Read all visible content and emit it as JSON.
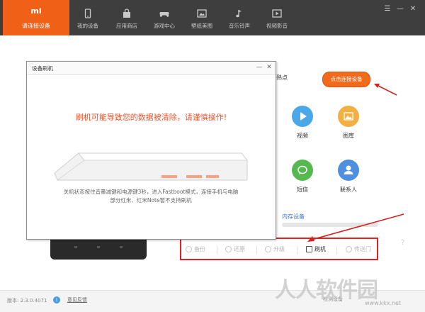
{
  "nav": {
    "brand_logo": "mi",
    "brand_label": "请连接设备",
    "items": [
      {
        "label": "我的设备",
        "icon": "phone-icon"
      },
      {
        "label": "应用商店",
        "icon": "bag-icon"
      },
      {
        "label": "游戏中心",
        "icon": "gamepad-icon"
      },
      {
        "label": "壁纸美图",
        "icon": "image-icon"
      },
      {
        "label": "音乐铃声",
        "icon": "music-icon"
      },
      {
        "label": "视频影音",
        "icon": "video-icon"
      }
    ],
    "accent_color": "#f06016"
  },
  "window_controls": {
    "menu": "☰",
    "minimize": "—",
    "close": "✕"
  },
  "main": {
    "connect_label": "熟点",
    "connect_button": "点击连接设备",
    "apps": [
      {
        "label": "视频",
        "icon": "play-icon",
        "color": "#4aa8e8"
      },
      {
        "label": "图库",
        "icon": "picture-icon",
        "color": "#f2b043"
      },
      {
        "label": "短信",
        "icon": "message-icon",
        "color": "#55b94f"
      },
      {
        "label": "联系人",
        "icon": "contact-icon",
        "color": "#4f8fe0"
      }
    ],
    "storage_label": "内存设备",
    "tools": [
      {
        "label": "备份",
        "icon": "backup-icon"
      },
      {
        "label": "还原",
        "icon": "restore-icon"
      },
      {
        "label": "升级",
        "icon": "upgrade-icon"
      },
      {
        "label": "刷机",
        "icon": "flash-icon"
      },
      {
        "label": "传送门",
        "icon": "send-icon"
      }
    ]
  },
  "dialog": {
    "title": "设备刷机",
    "minimize": "—",
    "close": "✕",
    "warning": "刷机可能导致您的数据被清除，请谨慎操作!",
    "hint_line1": "关机状态按住音量减键和电源键3秒，进入Fastboot模式，连接手机与电脑",
    "hint_line2": "部分红米、红米Note暂不支持刷机"
  },
  "statusbar": {
    "version": "版本: 2.3.0.4071",
    "info_icon": "i",
    "feedback": "意见反馈",
    "right_text": "检测设备"
  },
  "watermark": {
    "text": "人人软件园",
    "url": "www.kkx.net"
  }
}
